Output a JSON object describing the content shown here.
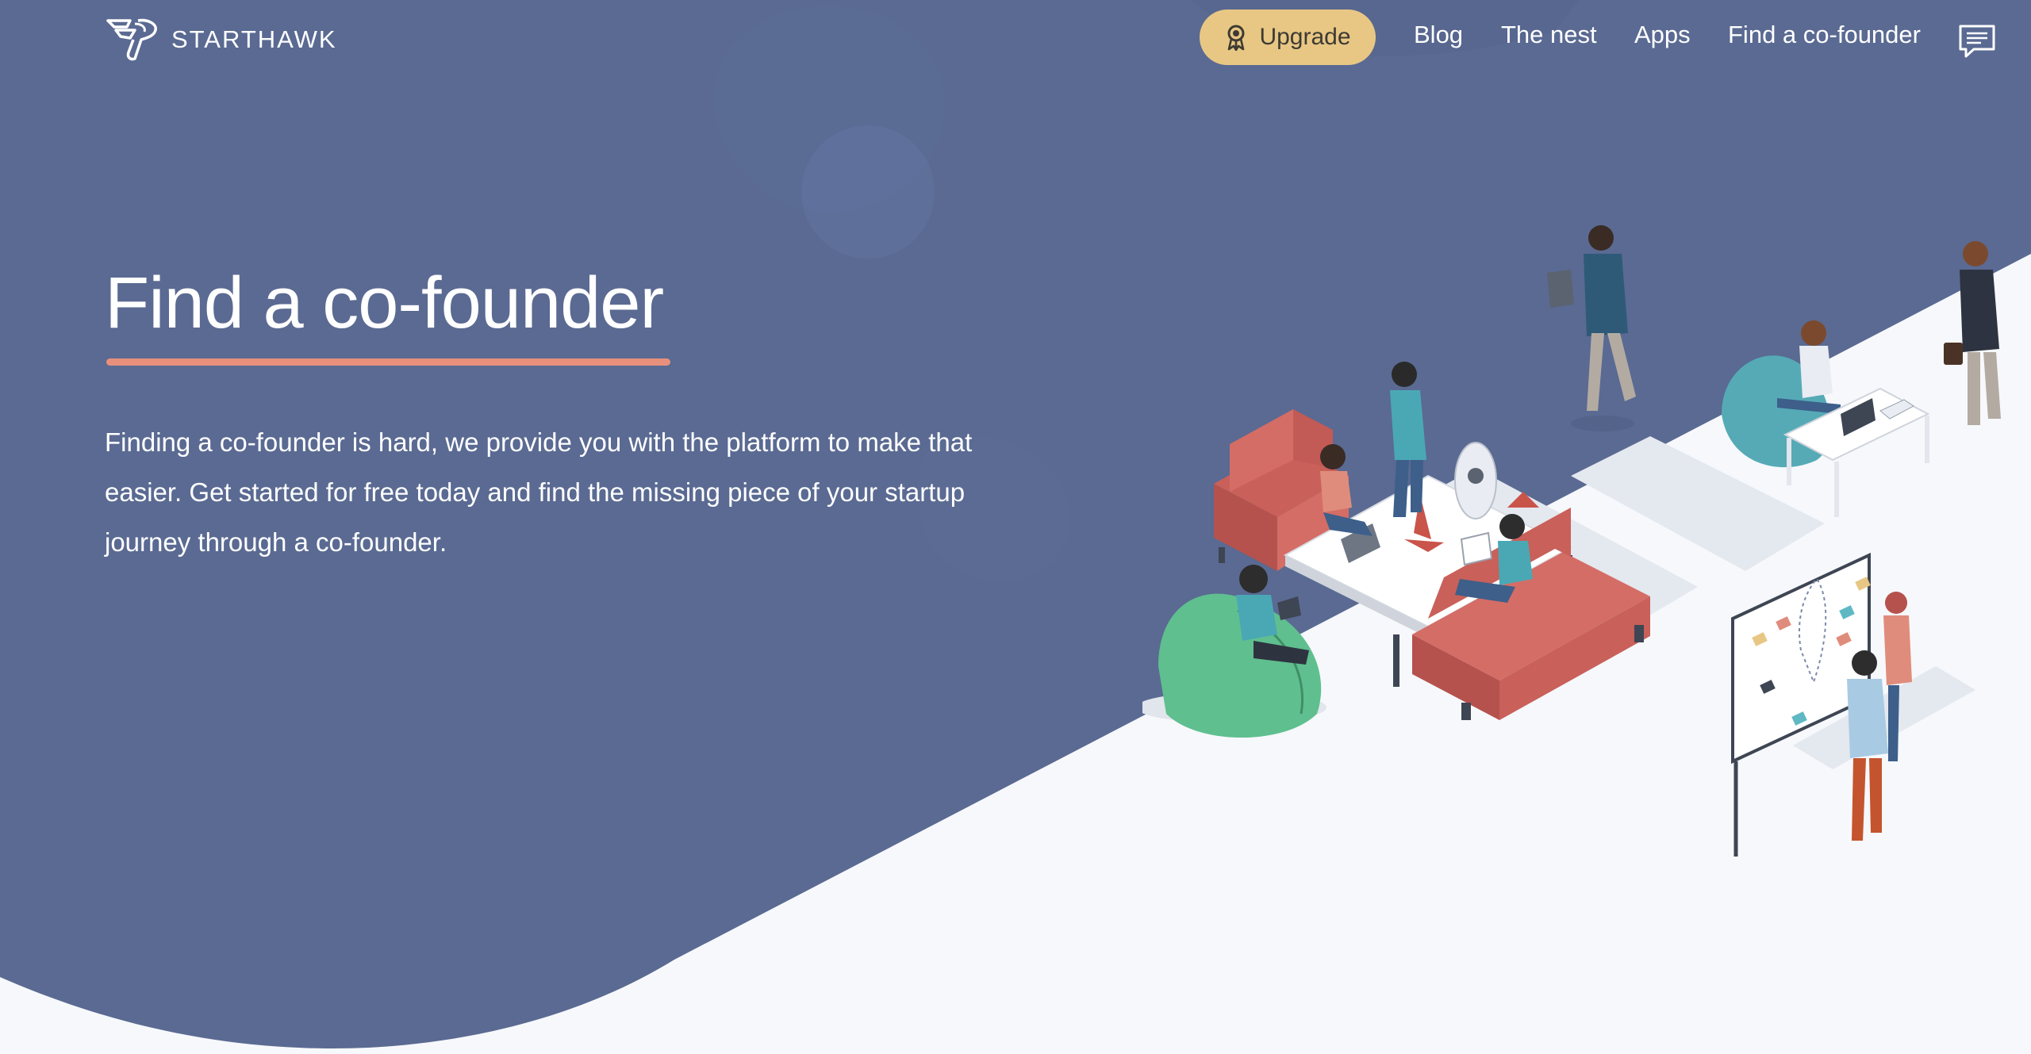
{
  "brand": {
    "name": "STARTHAWK",
    "logo_icon": "hawk-logo-icon"
  },
  "nav": {
    "upgrade_label": "Upgrade",
    "upgrade_icon": "award-ribbon-icon",
    "links": [
      "Blog",
      "The nest",
      "Apps",
      "Find a co-founder"
    ],
    "chat_icon": "chat-icon"
  },
  "hero": {
    "title": "Find a co-founder",
    "description": "Finding a co-founder is hard, we provide you with the platform to make that easier. Get started for free today and find the missing piece of your startup journey through a co-founder."
  },
  "colors": {
    "hero_bg": "#5a6a92",
    "light_bg": "#f6f8fb",
    "accent_underline": "#e8907c",
    "upgrade_bg": "#e8c784"
  }
}
